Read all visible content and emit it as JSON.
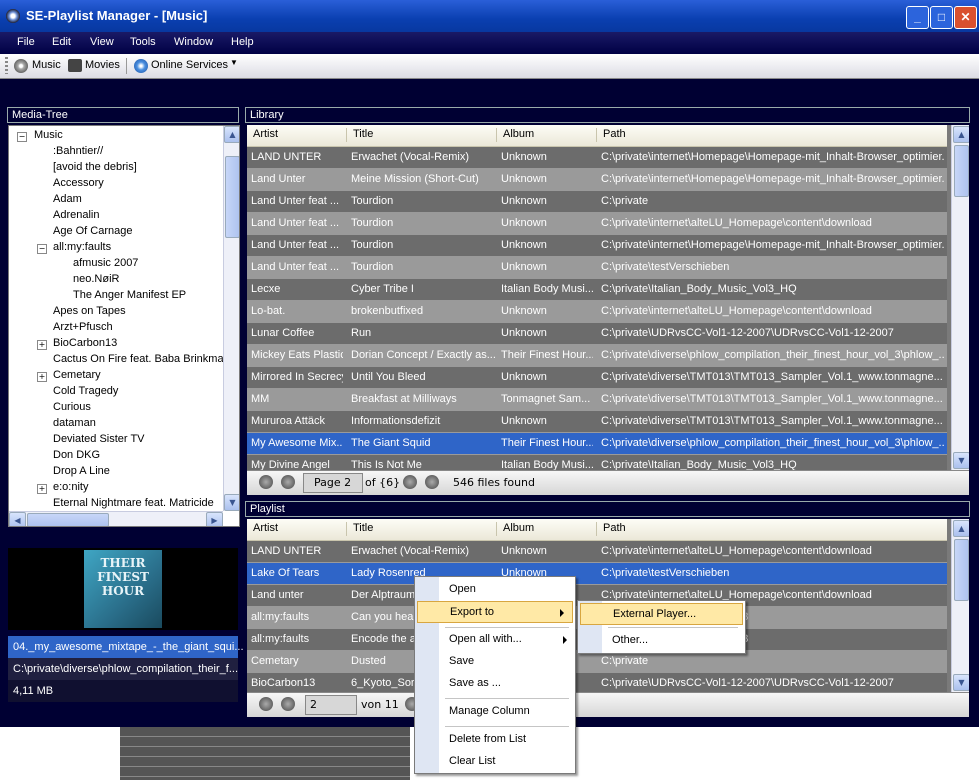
{
  "window": {
    "title": "SE-Playlist Manager - [Music]",
    "controls": [
      "_",
      "□",
      "✕"
    ]
  },
  "menubar": [
    "File",
    "Edit",
    "View",
    "Tools",
    "Window",
    "Help"
  ],
  "toolbar": {
    "music": "Music",
    "movies": "Movies",
    "online": "Online Services"
  },
  "media_tree": {
    "header": "Media-Tree",
    "root": "Music",
    "items": [
      ":Bahntier//",
      "[avoid the debris]",
      "Accessory",
      "Adam",
      "Adrenalin",
      "Age Of Carnage",
      "all:my:faults",
      "afmusic 2007",
      "neo.NøiR",
      "The Anger Manifest EP",
      "Apes on Tapes",
      "Arzt+Pfusch",
      "BioCarbon13",
      "Cactus On Fire feat. Baba Brinkman",
      "Cemetary",
      "Cold Tragedy",
      "Curious",
      "dataman",
      "Deviated Sister TV",
      "Don DKG",
      "Drop A Line",
      "e:o:nity",
      "Eternal Nightmare feat. Matricide",
      "Evolent"
    ]
  },
  "info": {
    "cover_text": "THEIR FINEST HOUR",
    "filename": "04._my_awesome_mixtape_-_the_giant_squi...",
    "path": "C:\\private\\diverse\\phlow_compilation_their_f...",
    "size": "4,11 MB"
  },
  "library": {
    "header": "Library",
    "columns": [
      "Artist",
      "Title",
      "Album",
      "Path"
    ],
    "rows": [
      [
        "LAND UNTER",
        "Erwachet (Vocal-Remix)",
        "Unknown",
        "C:\\private\\internet\\Homepage\\Homepage-mit_Inhalt-Browser_optimier..."
      ],
      [
        "Land Unter",
        "Meine Mission (Short-Cut)",
        "Unknown",
        "C:\\private\\internet\\Homepage\\Homepage-mit_Inhalt-Browser_optimier..."
      ],
      [
        "Land Unter feat ...",
        "Tourdion",
        "Unknown",
        "C:\\private"
      ],
      [
        "Land Unter feat ...",
        "Tourdion",
        "Unknown",
        "C:\\private\\internet\\alteLU_Homepage\\content\\download"
      ],
      [
        "Land Unter feat ...",
        "Tourdion",
        "Unknown",
        "C:\\private\\internet\\Homepage\\Homepage-mit_Inhalt-Browser_optimier..."
      ],
      [
        "Land Unter feat ...",
        "Tourdion",
        "Unknown",
        "C:\\private\\testVerschieben"
      ],
      [
        "Lecxe",
        "Cyber Tribe I",
        "Italian Body Musi...",
        "C:\\private\\Italian_Body_Music_Vol3_HQ"
      ],
      [
        "Lo-bat.",
        "brokenbutfixed",
        "Unknown",
        "C:\\private\\internet\\alteLU_Homepage\\content\\download"
      ],
      [
        "Lunar Coffee",
        "Run",
        "Unknown",
        "C:\\private\\UDRvsCC-Vol1-12-2007\\UDRvsCC-Vol1-12-2007"
      ],
      [
        "Mickey Eats Plastic",
        "Dorian Concept / Exactly as...",
        "Their Finest Hour...",
        "C:\\private\\diverse\\phlow_compilation_their_finest_hour_vol_3\\phlow_..."
      ],
      [
        "Mirrored In Secrecy",
        "Until You Bleed",
        "Unknown",
        "C:\\private\\diverse\\TMT013\\TMT013_Sampler_Vol.1_www.tonmagne..."
      ],
      [
        "MM",
        "Breakfast at Milliways",
        "Tonmagnet Sam...",
        "C:\\private\\diverse\\TMT013\\TMT013_Sampler_Vol.1_www.tonmagne..."
      ],
      [
        "Mururoa Attäck",
        "Informationsdefizit",
        "Unknown",
        "C:\\private\\diverse\\TMT013\\TMT013_Sampler_Vol.1_www.tonmagne..."
      ],
      [
        "My Awesome Mix...",
        "The Giant Squid",
        "Their Finest Hour...",
        "C:\\private\\diverse\\phlow_compilation_their_finest_hour_vol_3\\phlow_..."
      ],
      [
        "My Divine Angel",
        "This Is Not Me",
        "Italian Body Musi...",
        "C:\\private\\Italian_Body_Music_Vol3_HQ"
      ]
    ],
    "selected_index": 13,
    "pager": {
      "page": "Page 2",
      "of": "of {6}",
      "found": "546 files found"
    }
  },
  "playlist": {
    "header": "Playlist",
    "columns": [
      "Artist",
      "Title",
      "Album",
      "Path"
    ],
    "rows": [
      [
        "LAND UNTER",
        "Erwachet (Vocal-Remix)",
        "Unknown",
        "C:\\private\\internet\\alteLU_Homepage\\content\\download"
      ],
      [
        "Lake Of Tears",
        "Lady Rosenred",
        "Unknown",
        "C:\\private\\testVerschieben"
      ],
      [
        "Land unter",
        "Der Alptraum",
        "",
        "C:\\private\\internet\\alteLU_Homepage\\content\\download"
      ],
      [
        "all:my:faults",
        "Can you hear",
        "",
        "myfaults_neonoir_192kb_mp3"
      ],
      [
        "all:my:faults",
        "Encode the a",
        "",
        "myfaults_neonoir_192kb_mp3"
      ],
      [
        "Cemetary",
        "Dusted",
        "",
        "C:\\private"
      ],
      [
        "BioCarbon13",
        "6_Kyoto_Sor",
        "",
        "C:\\private\\UDRvsCC-Vol1-12-2007\\UDRvsCC-Vol1-12-2007"
      ]
    ],
    "selected_index": 1,
    "pager": {
      "page": "2",
      "of": "von 11"
    }
  },
  "context_menu": {
    "items": [
      "Open",
      "Export to",
      "Open all with...",
      "Save",
      "Save as ...",
      "Manage Column",
      "Delete from List",
      "Clear List"
    ],
    "submenu": [
      "External Player...",
      "Other..."
    ]
  }
}
